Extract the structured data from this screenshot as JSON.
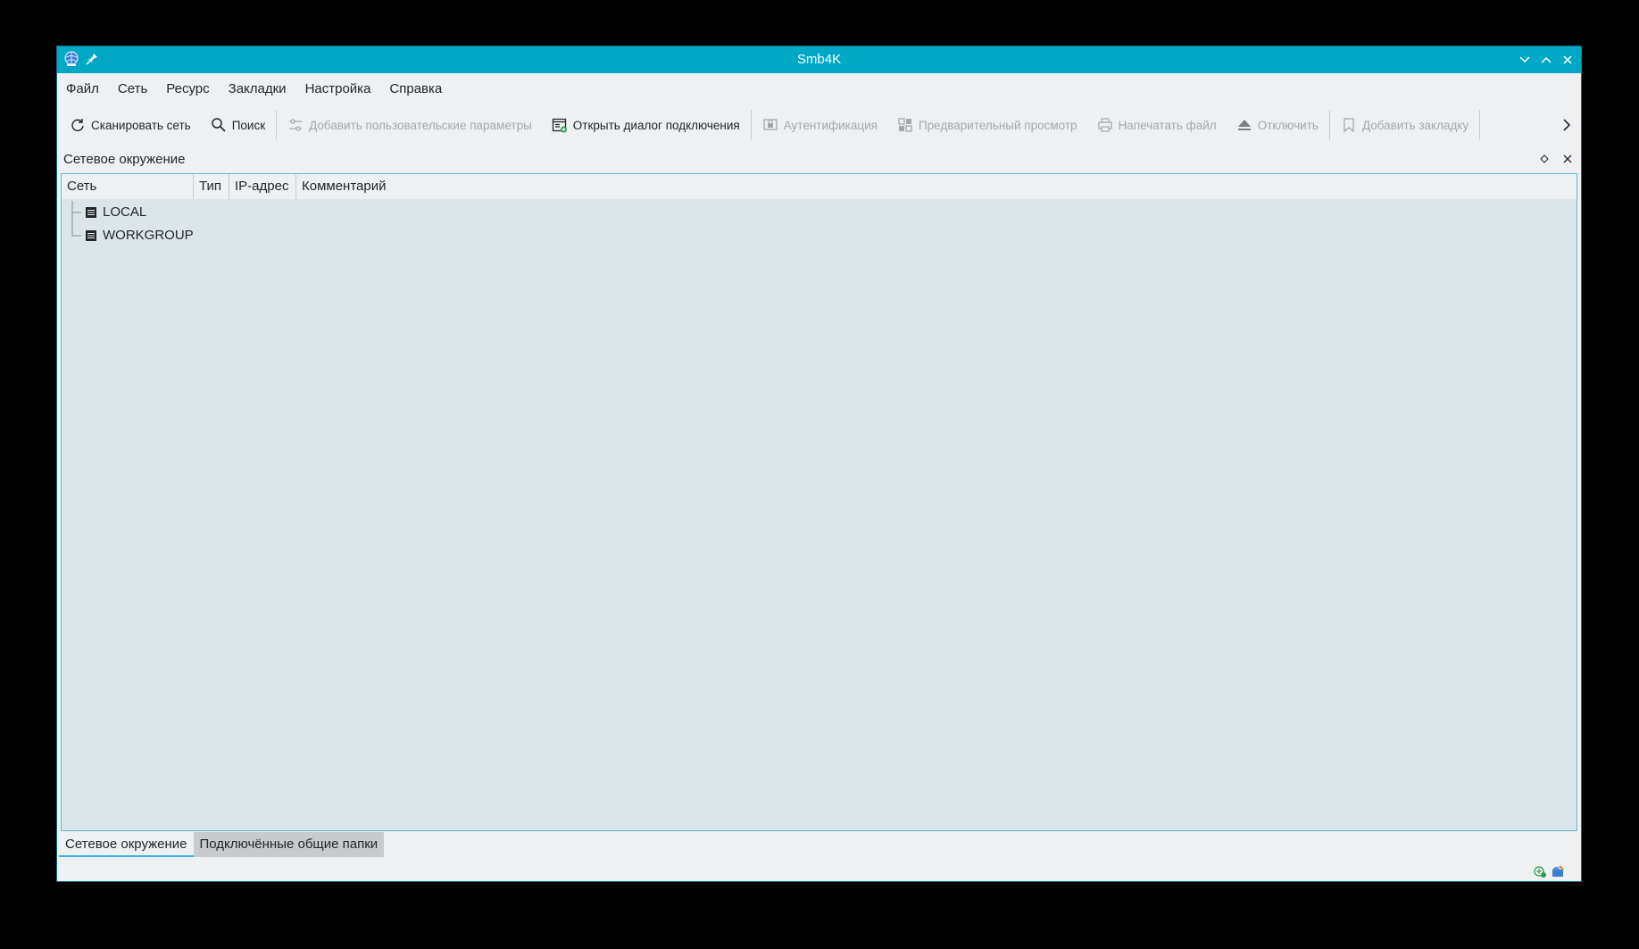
{
  "window": {
    "title": "Smb4K"
  },
  "menubar": {
    "items": [
      "Файл",
      "Сеть",
      "Ресурс",
      "Закладки",
      "Настройка",
      "Справка"
    ]
  },
  "toolbar": {
    "scan": "Сканировать сеть",
    "search": "Поиск",
    "add_custom_options": "Добавить пользовательские параметры",
    "open_mount_dialog": "Открыть диалог подключения",
    "authentication": "Аутентификация",
    "preview": "Предварительный просмотр",
    "print_file": "Напечатать файл",
    "unmount": "Отключить",
    "add_bookmark": "Добавить закладку"
  },
  "dock": {
    "title": "Сетевое окружение"
  },
  "tree": {
    "columns": [
      "Сеть",
      "Тип",
      "IP-адрес",
      "Комментарий"
    ],
    "rows": [
      {
        "label": "LOCAL",
        "icon": "network-workgroup-icon"
      },
      {
        "label": "WORKGROUP",
        "icon": "network-workgroup-icon"
      }
    ]
  },
  "tabs": [
    {
      "label": "Сетевое окружение",
      "active": true
    },
    {
      "label": "Подключённые общие папки",
      "active": false
    }
  ],
  "colors": {
    "titlebar": "#00a8c6",
    "accent": "#3daee9",
    "tree_bg": "#dce5ea",
    "window_bg": "#eff0f1"
  }
}
